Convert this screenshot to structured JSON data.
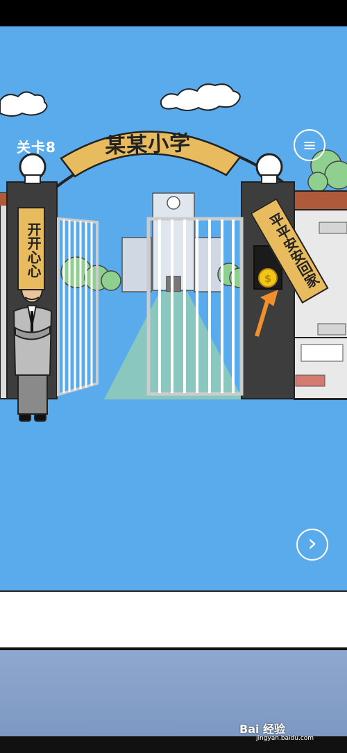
{
  "game": {
    "level_label": "关卡8",
    "arch_sign": "某某小学",
    "left_pillar_sign": "开开心心",
    "right_pillar_sign": "平平安安回家"
  },
  "controls": {
    "menu_icon": "≡",
    "next_icon": "›"
  },
  "watermark": {
    "brand": "Bai 经验",
    "url": "jingyan.baidu.com"
  },
  "colors": {
    "sky": "#5aabec",
    "sign": "#e8bc5e",
    "pillar": "#3c3c3c",
    "arrow": "#f0902c",
    "coin": "#f2c617"
  }
}
